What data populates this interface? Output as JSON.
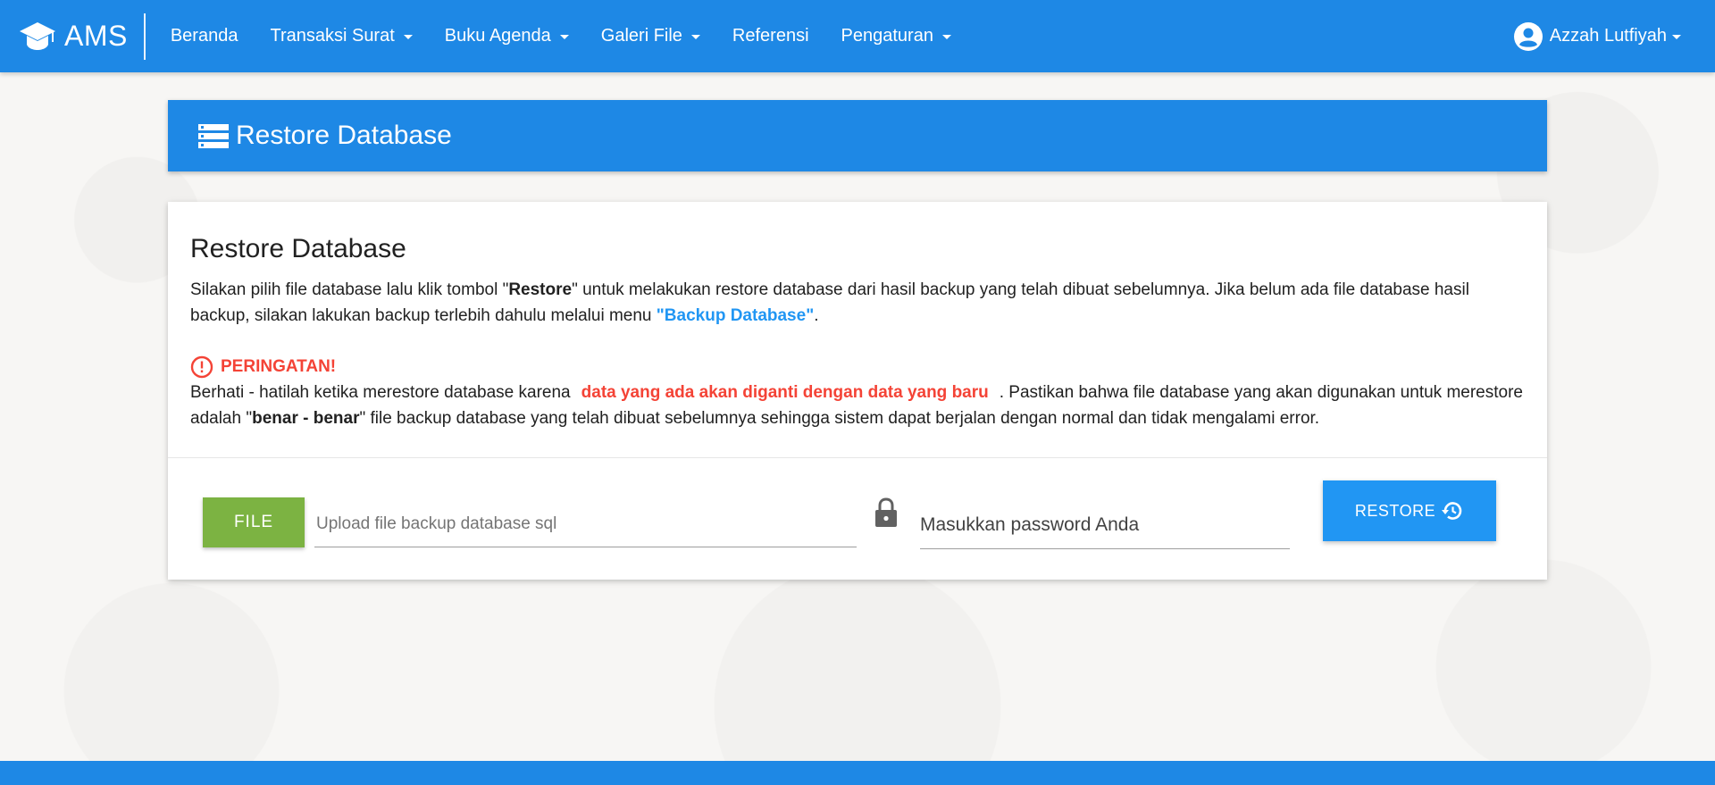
{
  "app": {
    "brand": "AMS",
    "accent_color": "#1e88e5"
  },
  "nav": {
    "items": [
      {
        "label": "Beranda",
        "dropdown": false
      },
      {
        "label": "Transaksi Surat",
        "dropdown": true
      },
      {
        "label": "Buku Agenda",
        "dropdown": true
      },
      {
        "label": "Galeri File",
        "dropdown": true
      },
      {
        "label": "Referensi",
        "dropdown": false
      },
      {
        "label": "Pengaturan",
        "dropdown": true
      }
    ],
    "user": {
      "name": "Azzah Lutfiyah",
      "icon": "account-circle-icon"
    }
  },
  "header": {
    "title": "Restore Database",
    "icon": "storage-icon"
  },
  "card": {
    "title": "Restore Database",
    "desc_part1": "Silakan pilih file database lalu klik tombol \"",
    "desc_bold": "Restore",
    "desc_part2": "\" untuk melakukan restore database dari hasil backup yang telah dibuat sebelumnya. Jika belum ada file database hasil backup, silakan lakukan backup terlebih dahulu melalui menu ",
    "desc_link": "\"Backup Database\"",
    "desc_end": ".",
    "warning_title": "PERINGATAN!",
    "warning_part1": "Berhati - hatilah ketika merestore database karena",
    "warning_red": "data yang ada akan diganti dengan data yang baru",
    "warning_part2": ". Pastikan bahwa file database yang akan digunakan untuk merestore adalah \"",
    "warning_bold": "benar - benar",
    "warning_part3": "\" file backup database yang telah dibuat sebelumnya sehingga sistem dapat berjalan dengan normal dan tidak mengalami error.",
    "warning_color": "#f44336",
    "link_color": "#2196f3"
  },
  "form": {
    "file_button": "FILE",
    "file_placeholder": "Upload file backup database sql",
    "password_placeholder": "Masukkan password Anda",
    "restore_button": "RESTORE",
    "file_button_color": "#7cb342",
    "restore_button_color": "#2196f3"
  }
}
